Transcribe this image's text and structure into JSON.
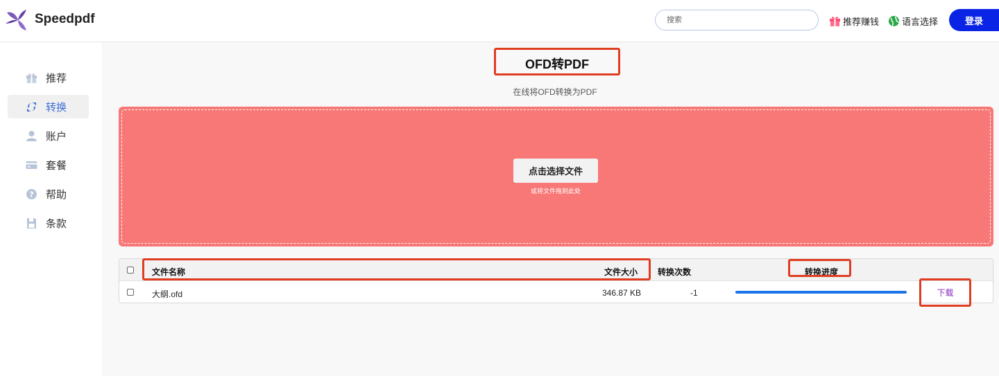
{
  "header": {
    "brand": "Speedpdf",
    "search_placeholder": "搜索",
    "referral_label": "推荐赚钱",
    "language_label": "语言选择",
    "login_label": "登录"
  },
  "sidebar": {
    "items": [
      {
        "label": "推荐",
        "icon": "gift-icon"
      },
      {
        "label": "转换",
        "icon": "convert-icon",
        "active": true
      },
      {
        "label": "账户",
        "icon": "user-icon"
      },
      {
        "label": "套餐",
        "icon": "card-icon"
      },
      {
        "label": "帮助",
        "icon": "help-icon"
      },
      {
        "label": "条款",
        "icon": "document-icon"
      }
    ]
  },
  "main": {
    "title": "OFD转PDF",
    "subtitle": "在线将OFD转换为PDF",
    "dropzone": {
      "button_label": "点击选择文件",
      "hint": "或将文件拖到此处"
    },
    "table": {
      "headers": {
        "name": "文件名称",
        "size": "文件大小",
        "count": "转换次数",
        "progress": "转换进度"
      },
      "rows": [
        {
          "name": "大纲.ofd",
          "size": "346.87 KB",
          "count": "-1",
          "progress": 1.0,
          "action": "下载"
        }
      ]
    }
  },
  "colors": {
    "accent": "#0a24e6",
    "dropzone": "#f77876",
    "highlight": "#e03c22",
    "progress": "#1a73e8",
    "download_link": "#8a2bbf"
  }
}
